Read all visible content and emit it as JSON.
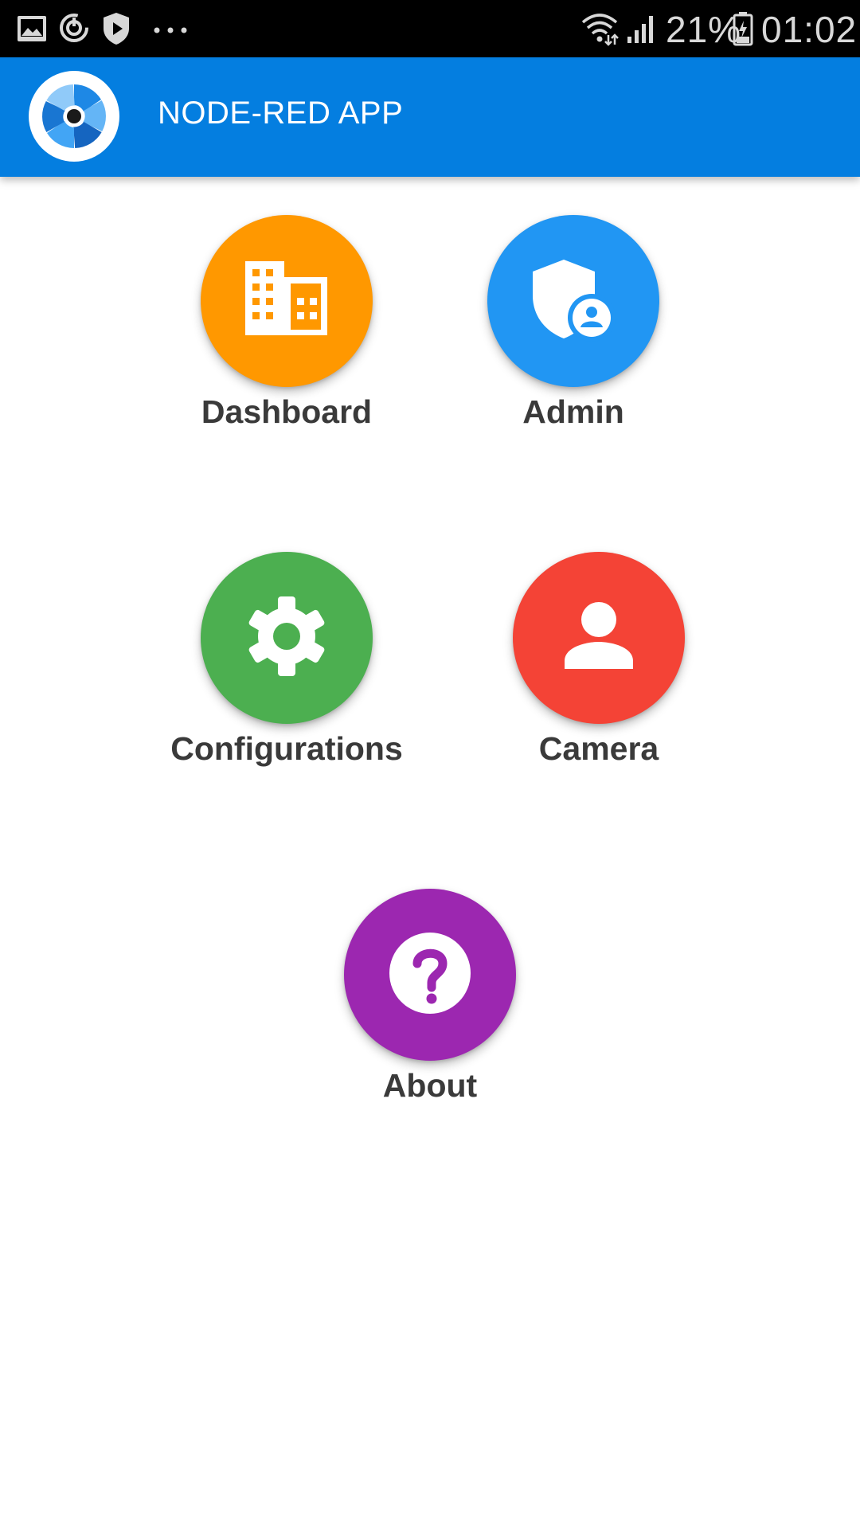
{
  "status_bar": {
    "left_icons": [
      "gallery-icon",
      "sync-icon",
      "shield-play-icon",
      "more-dots-icon"
    ],
    "battery_percent": "21%",
    "time": "01:02"
  },
  "app_bar": {
    "title": "NODE-RED APP",
    "background": "#047ee0"
  },
  "menu": {
    "dashboard": {
      "label": "Dashboard",
      "color": "#ff9800",
      "icon": "building-icon"
    },
    "admin": {
      "label": "Admin",
      "color": "#2196f3",
      "icon": "admin-shield-icon"
    },
    "configurations": {
      "label": "Configurations",
      "color": "#4caf50",
      "icon": "gear-icon"
    },
    "camera": {
      "label": "Camera",
      "color": "#f44336",
      "icon": "person-icon"
    },
    "about": {
      "label": "About",
      "color": "#9c27b0",
      "icon": "help-icon"
    }
  }
}
